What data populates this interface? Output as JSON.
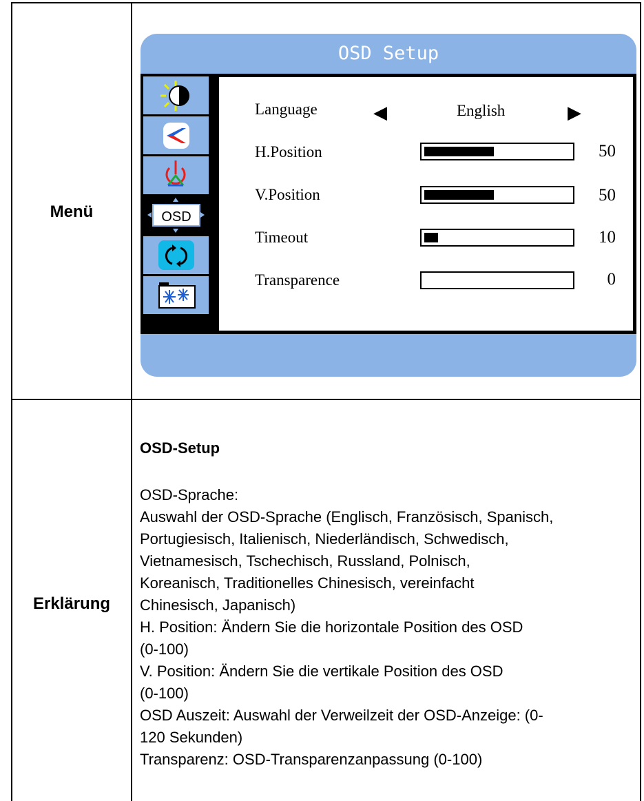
{
  "table": {
    "row1_label": "Menü",
    "row2_label": "Erklärung"
  },
  "osd": {
    "title": "OSD Setup",
    "colors": {
      "frame": "#8bb3e6",
      "panel": "#ffffff",
      "border": "#000000"
    },
    "side_icons": [
      "brightness-contrast-icon",
      "image-position-icon",
      "color-icon",
      "osd-icon",
      "reset-icon",
      "misc-setting-icon"
    ],
    "side_selected": "osd-icon",
    "side_osd_label": "OSD",
    "options": {
      "language": {
        "label": "Language",
        "value": "English",
        "left_arrow": "◀",
        "right_arrow": "▶"
      },
      "h_position": {
        "label": "H.Position",
        "value": "50",
        "level": 0.5
      },
      "v_position": {
        "label": "V.Position",
        "value": "50",
        "level": 0.5
      },
      "timeout": {
        "label": "Timeout",
        "value": "10",
        "level": 0.1
      },
      "transparence": {
        "label": "Transparence",
        "value": "0",
        "level": 0
      }
    }
  },
  "explanation": {
    "heading": "OSD-Setup",
    "lines": [
      "OSD-Sprache:",
      "Auswahl der OSD-Sprache  (Englisch, Französisch, Spanisch,",
      "Portugiesisch, Italienisch, Niederländisch, Schwedisch,",
      "Vietnamesisch, Tschechisch, Russland, Polnisch,",
      "Koreanisch, Traditionelles Chinesisch, vereinfacht",
      "Chinesisch, Japanisch)",
      "H. Position: Ändern Sie die horizontale Position des OSD",
      "(0-100)",
      "V. Position: Ändern Sie die vertikale Position des OSD",
      "(0-100)",
      "OSD Auszeit: Auswahl der Verweilzeit der OSD-Anzeige: (0-",
      "120 Sekunden)",
      "Transparenz: OSD-Transparenzanpassung (0-100)"
    ]
  }
}
